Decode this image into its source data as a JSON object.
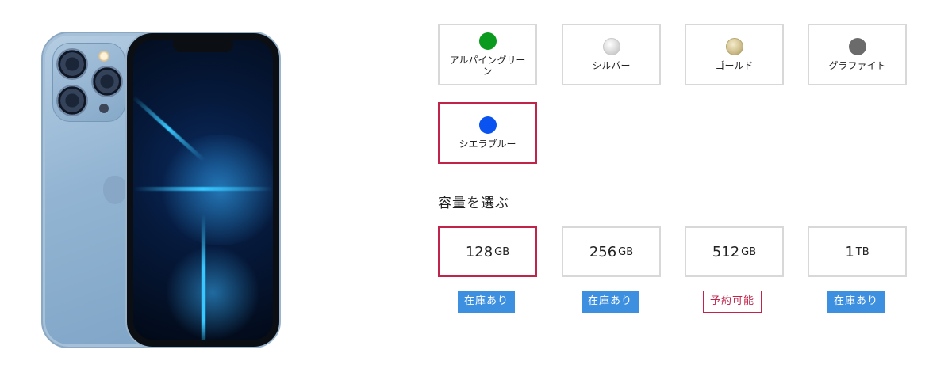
{
  "colors": [
    {
      "label": "アルパイングリーン",
      "swatch": "#0a9a1e",
      "selected": false
    },
    {
      "label": "シルバー",
      "swatch": "#e3e3e3",
      "selected": false
    },
    {
      "label": "ゴールド",
      "swatch": "#cdbd8a",
      "selected": false
    },
    {
      "label": "グラファイト",
      "swatch": "#6b6b6b",
      "selected": false
    },
    {
      "label": "シエラブルー",
      "swatch": "#0a53f0",
      "selected": true
    }
  ],
  "capacity_section": {
    "title": "容量を選ぶ"
  },
  "capacities": [
    {
      "num": "128",
      "unit": "GB",
      "stock": "在庫あり",
      "stock_type": "instock",
      "selected": true
    },
    {
      "num": "256",
      "unit": "GB",
      "stock": "在庫あり",
      "stock_type": "instock",
      "selected": false
    },
    {
      "num": "512",
      "unit": "GB",
      "stock": "予約可能",
      "stock_type": "reserve",
      "selected": false
    },
    {
      "num": "1",
      "unit": "TB",
      "stock": "在庫あり",
      "stock_type": "instock",
      "selected": false
    }
  ],
  "theme": {
    "selected_border": "#c0244a",
    "instock_bg": "#3d8fe0"
  }
}
